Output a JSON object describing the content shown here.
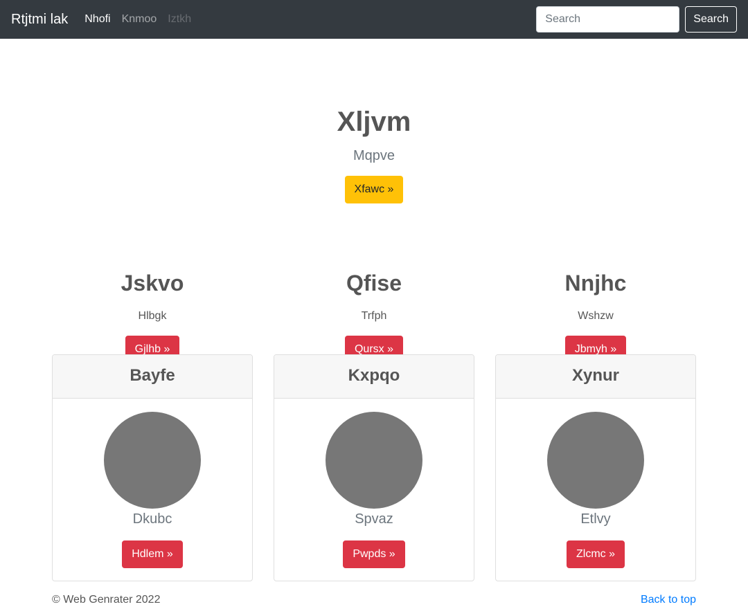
{
  "navbar": {
    "brand": "Rtjtmi lak",
    "links": [
      {
        "label": "Nhofi",
        "state": "active"
      },
      {
        "label": "Knmoo",
        "state": "normal"
      },
      {
        "label": "Iztkh",
        "state": "disabled"
      }
    ],
    "search_placeholder": "Search",
    "search_button": "Search"
  },
  "hero": {
    "title": "Xljvm",
    "subtitle": "Mqpve",
    "button": "Xfawc »"
  },
  "features": [
    {
      "heading": "Jskvo",
      "text": "Hlbgk",
      "button": "Gjlhb »"
    },
    {
      "heading": "Qfise",
      "text": "Trfph",
      "button": "Qursx »"
    },
    {
      "heading": "Nnjhc",
      "text": "Wshzw",
      "button": "Jbmyh »"
    }
  ],
  "cards": [
    {
      "title": "Bayfe",
      "name": "Dkubc",
      "button": "Hdlem »"
    },
    {
      "title": "Kxpqo",
      "name": "Spvaz",
      "button": "Pwpds »"
    },
    {
      "title": "Xynur",
      "name": "Etlvy",
      "button": "Zlcmc »"
    }
  ],
  "footer": {
    "copyright": "© Web Genrater 2022",
    "back_to_top": "Back to top"
  },
  "colors": {
    "navbar_bg": "#343a40",
    "warning": "#ffc107",
    "danger": "#dc3545",
    "link": "#007bff",
    "avatar": "#777777"
  }
}
